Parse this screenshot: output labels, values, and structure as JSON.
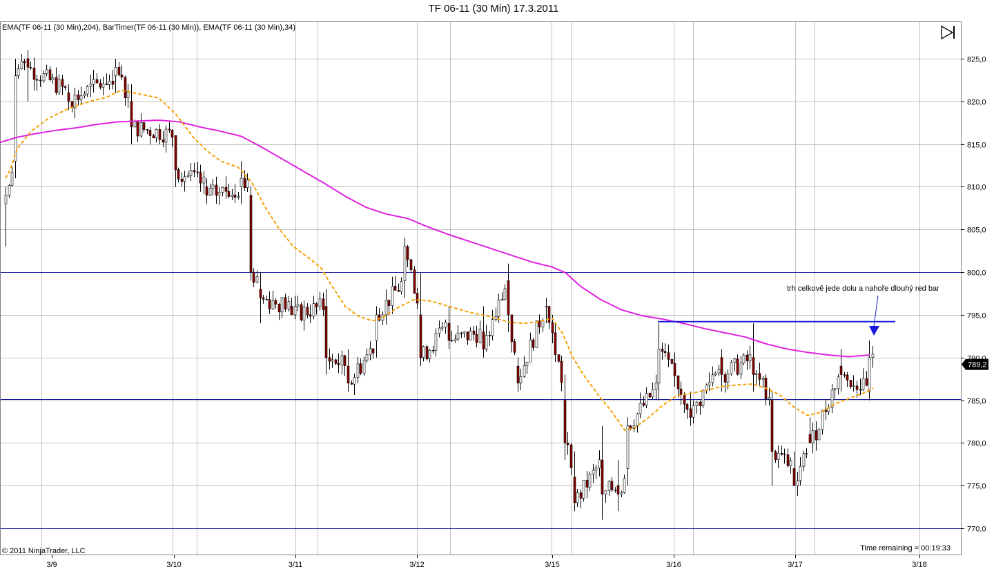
{
  "header": {
    "title": "TF 06-11 (30 Min)  17.3.2011"
  },
  "indicators_label": "EMA(TF 06-11 (30 Min),204), BarTimer(TF 06-11 (30 Min)), EMA(TF 06-11 (30 Min),34)",
  "copyright": "© 2011 NinjaTrader, LLC",
  "time_remaining": "Time remaining = 00:19:33",
  "annotation": "trh celkově jede dolu a nahoře dlouhý red bar",
  "last_price": "789,2",
  "colors": {
    "ema204": "#e020e0",
    "ema34": "#f5a000",
    "level_line": "#1a1aa0",
    "resistance": "#1a1adc",
    "candle_up": "#ffffff",
    "candle_down": "#8b0000",
    "grid": "#c0c0c0"
  },
  "icons": {
    "replay": "skip-to-end-icon",
    "arrow": "down-arrow-icon"
  },
  "chart_data": {
    "type": "candlestick",
    "title": "TF 06-11 (30 Min)  17.3.2011",
    "x_ticks": [
      "3/9",
      "3/10",
      "3/11",
      "3/12",
      "3/15",
      "3/16",
      "3/17",
      "3/18"
    ],
    "y_ticks": [
      "825,0",
      "820,0",
      "815,0",
      "810,0",
      "805,0",
      "800,0",
      "795,0",
      "790,0",
      "785,0",
      "780,0",
      "775,0",
      "770,0"
    ],
    "ylim": [
      767,
      828
    ],
    "horizontal_levels": [
      800.0,
      785.1,
      770.0
    ],
    "resistance_level": 794.2,
    "last_close": 789.2,
    "series": [
      {
        "name": "EMA(TF 06-11 (30 Min),204)",
        "style": "solid",
        "points": [
          [
            0,
            815.2
          ],
          [
            25,
            815.8
          ],
          [
            50,
            816.2
          ],
          [
            80,
            816.6
          ],
          [
            110,
            816.9
          ],
          [
            140,
            817.3
          ],
          [
            170,
            817.6
          ],
          [
            200,
            817.7
          ],
          [
            230,
            817.8
          ],
          [
            260,
            817.6
          ],
          [
            290,
            817.0
          ],
          [
            320,
            816.5
          ],
          [
            350,
            815.9
          ],
          [
            380,
            814.6
          ],
          [
            410,
            813.2
          ],
          [
            440,
            811.8
          ],
          [
            470,
            810.4
          ],
          [
            500,
            808.9
          ],
          [
            530,
            807.6
          ],
          [
            560,
            806.8
          ],
          [
            590,
            806.3
          ],
          [
            620,
            805.3
          ],
          [
            650,
            804.4
          ],
          [
            680,
            803.6
          ],
          [
            710,
            802.8
          ],
          [
            740,
            802.0
          ],
          [
            770,
            801.2
          ],
          [
            800,
            800.6
          ],
          [
            820,
            799.9
          ],
          [
            840,
            798.4
          ],
          [
            870,
            796.8
          ],
          [
            900,
            795.6
          ],
          [
            930,
            794.9
          ],
          [
            960,
            794.5
          ],
          [
            990,
            794.0
          ],
          [
            1020,
            793.4
          ],
          [
            1050,
            792.9
          ],
          [
            1080,
            792.4
          ],
          [
            1110,
            791.6
          ],
          [
            1140,
            791.0
          ],
          [
            1170,
            790.6
          ],
          [
            1200,
            790.3
          ],
          [
            1230,
            790.1
          ],
          [
            1260,
            790.3
          ]
        ]
      },
      {
        "name": "EMA(TF 06-11 (30 Min),34)",
        "style": "dashed",
        "points": [
          [
            8,
            811.0
          ],
          [
            15,
            812.0
          ],
          [
            25,
            814.5
          ],
          [
            45,
            816.5
          ],
          [
            70,
            818.0
          ],
          [
            100,
            819.2
          ],
          [
            130,
            820.0
          ],
          [
            155,
            820.5
          ],
          [
            175,
            821.3
          ],
          [
            200,
            820.9
          ],
          [
            230,
            820.4
          ],
          [
            255,
            818.5
          ],
          [
            280,
            815.8
          ],
          [
            300,
            814.2
          ],
          [
            320,
            813.0
          ],
          [
            345,
            812.3
          ],
          [
            365,
            810.5
          ],
          [
            385,
            807.5
          ],
          [
            405,
            805.0
          ],
          [
            425,
            803.0
          ],
          [
            450,
            801.5
          ],
          [
            465,
            800.5
          ],
          [
            480,
            798.5
          ],
          [
            500,
            796.0
          ],
          [
            520,
            794.8
          ],
          [
            540,
            794.3
          ],
          [
            555,
            794.7
          ],
          [
            575,
            795.8
          ],
          [
            600,
            796.8
          ],
          [
            625,
            796.6
          ],
          [
            650,
            796.0
          ],
          [
            680,
            795.3
          ],
          [
            710,
            794.8
          ],
          [
            740,
            794.1
          ],
          [
            760,
            794.0
          ],
          [
            780,
            794.2
          ],
          [
            800,
            794.6
          ],
          [
            815,
            792.8
          ],
          [
            830,
            790.0
          ],
          [
            845,
            788.0
          ],
          [
            865,
            785.8
          ],
          [
            885,
            783.8
          ],
          [
            905,
            781.5
          ],
          [
            920,
            781.8
          ],
          [
            940,
            783.0
          ],
          [
            960,
            784.4
          ],
          [
            980,
            785.5
          ],
          [
            1000,
            785.8
          ],
          [
            1020,
            786.1
          ],
          [
            1045,
            786.6
          ],
          [
            1070,
            786.8
          ],
          [
            1090,
            786.9
          ],
          [
            1110,
            786.4
          ],
          [
            1130,
            785.6
          ],
          [
            1150,
            784.2
          ],
          [
            1170,
            783.2
          ],
          [
            1190,
            783.6
          ],
          [
            1210,
            784.6
          ],
          [
            1230,
            785.2
          ],
          [
            1250,
            785.8
          ],
          [
            1265,
            786.4
          ]
        ]
      }
    ],
    "candles_sample": [
      {
        "x": 10,
        "o": 808,
        "h": 810,
        "c": 809,
        "l": 803
      },
      {
        "x": 20,
        "o": 813,
        "h": 825,
        "c": 823,
        "l": 811
      },
      {
        "x": 40,
        "o": 825,
        "h": 826,
        "c": 824,
        "l": 820
      },
      {
        "x": 100,
        "o": 821,
        "h": 822,
        "c": 820,
        "l": 819
      },
      {
        "x": 165,
        "o": 823,
        "h": 825,
        "c": 824,
        "l": 821
      },
      {
        "x": 190,
        "o": 820,
        "h": 822,
        "c": 817,
        "l": 815
      },
      {
        "x": 255,
        "o": 816,
        "h": 816,
        "c": 812,
        "l": 810
      },
      {
        "x": 300,
        "o": 810,
        "h": 811,
        "c": 809,
        "l": 808
      },
      {
        "x": 350,
        "o": 810,
        "h": 813,
        "c": 811,
        "l": 808
      },
      {
        "x": 365,
        "o": 809,
        "h": 810,
        "c": 800,
        "l": 799
      },
      {
        "x": 375,
        "o": 798,
        "h": 800,
        "c": 797,
        "l": 794
      },
      {
        "x": 420,
        "o": 796,
        "h": 797,
        "c": 795,
        "l": 795
      },
      {
        "x": 470,
        "o": 796,
        "h": 798,
        "c": 790,
        "l": 788
      },
      {
        "x": 505,
        "o": 789,
        "h": 791,
        "c": 787,
        "l": 786
      },
      {
        "x": 545,
        "o": 792,
        "h": 796,
        "c": 795,
        "l": 790
      },
      {
        "x": 585,
        "o": 799,
        "h": 804,
        "c": 803,
        "l": 797
      },
      {
        "x": 610,
        "o": 795,
        "h": 800,
        "c": 790,
        "l": 789
      },
      {
        "x": 650,
        "o": 794,
        "h": 796,
        "c": 792,
        "l": 791
      },
      {
        "x": 700,
        "o": 793,
        "h": 796,
        "c": 791,
        "l": 790
      },
      {
        "x": 735,
        "o": 799,
        "h": 801,
        "c": 795,
        "l": 793
      },
      {
        "x": 748,
        "o": 789,
        "h": 790,
        "c": 787,
        "l": 786
      },
      {
        "x": 790,
        "o": 796,
        "h": 797,
        "c": 796,
        "l": 794
      },
      {
        "x": 820,
        "o": 785,
        "h": 788,
        "c": 780,
        "l": 778
      },
      {
        "x": 832,
        "o": 776,
        "h": 779,
        "c": 773,
        "l": 772
      },
      {
        "x": 872,
        "o": 778,
        "h": 782,
        "c": 774,
        "l": 771
      },
      {
        "x": 895,
        "o": 775,
        "h": 778,
        "c": 774,
        "l": 772
      },
      {
        "x": 910,
        "o": 777,
        "h": 783,
        "c": 782,
        "l": 775
      },
      {
        "x": 955,
        "o": 787,
        "h": 794,
        "c": 791,
        "l": 785
      },
      {
        "x": 1000,
        "o": 784,
        "h": 786,
        "c": 783,
        "l": 782
      },
      {
        "x": 1045,
        "o": 790,
        "h": 791,
        "c": 788,
        "l": 786
      },
      {
        "x": 1092,
        "o": 790,
        "h": 794,
        "c": 788,
        "l": 786
      },
      {
        "x": 1120,
        "o": 785,
        "h": 786,
        "c": 779,
        "l": 775
      },
      {
        "x": 1148,
        "o": 777,
        "h": 779,
        "c": 775,
        "l": 775
      },
      {
        "x": 1175,
        "o": 781,
        "h": 783,
        "c": 780,
        "l": 780
      },
      {
        "x": 1220,
        "o": 789,
        "h": 791,
        "c": 788,
        "l": 786
      },
      {
        "x": 1260,
        "o": 786,
        "h": 792,
        "c": 790,
        "l": 785
      },
      {
        "x": 1268,
        "o": 790,
        "h": 790,
        "c": 789,
        "l": 788
      }
    ]
  }
}
